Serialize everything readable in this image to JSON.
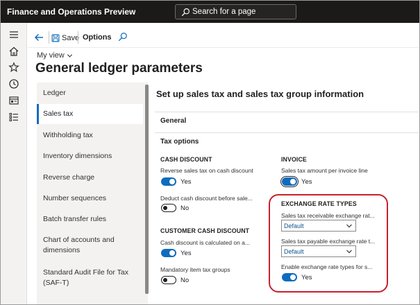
{
  "app": {
    "title": "Finance and Operations Preview"
  },
  "search": {
    "label": "Search for a page"
  },
  "nav_rail": [
    "hamburger-icon",
    "home-icon",
    "star-icon",
    "clock-icon",
    "workspace-icon",
    "list-icon"
  ],
  "action_pane": {
    "save_label": "Save",
    "options_label": "Options"
  },
  "header": {
    "view_label": "My view",
    "title": "General ledger parameters"
  },
  "tabs": [
    "Ledger",
    "Sales tax",
    "Withholding tax",
    "Inventory dimensions",
    "Reverse charge",
    "Number sequences",
    "Batch transfer rules",
    "Chart of accounts and dimensions",
    "Standard Audit File for Tax (SAF-T)"
  ],
  "selected_tab": "Sales tax",
  "content": {
    "heading": "Set up sales tax and sales tax group information",
    "section_general": "General",
    "section_tax_options": "Tax options",
    "cash_discount": {
      "heading": "CASH DISCOUNT",
      "reverse_label": "Reverse sales tax on cash discount",
      "reverse_value": "Yes",
      "deduct_label": "Deduct cash discount before sale...",
      "deduct_value": "No"
    },
    "customer_cash_discount": {
      "heading": "CUSTOMER CASH DISCOUNT",
      "calculated_label": "Cash discount is calculated on a...",
      "calculated_value": "Yes",
      "mandatory_label": "Mandatory item tax groups",
      "mandatory_value": "No"
    },
    "invoice": {
      "heading": "INVOICE",
      "amount_label": "Sales tax amount per invoice line",
      "amount_value": "Yes"
    },
    "exchange_rate_types": {
      "heading": "EXCHANGE RATE TYPES",
      "receivable_label": "Sales tax receivable exchange rat...",
      "receivable_value": "Default",
      "payable_label": "Sales tax payable exchange rate t...",
      "payable_value": "Default",
      "enable_label": "Enable exchange rate types for s...",
      "enable_value": "Yes"
    }
  },
  "colors": {
    "accent": "#0f6cbd",
    "topbar": "#1b1a19",
    "highlight": "#c7202e"
  }
}
